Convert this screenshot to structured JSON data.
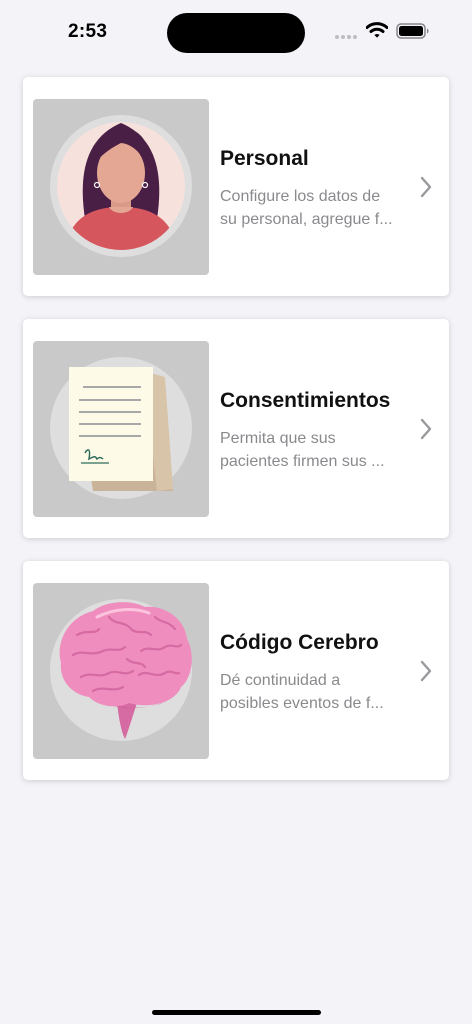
{
  "status_bar": {
    "time": "2:53"
  },
  "cards": [
    {
      "title": "Personal",
      "desc_line1": "Configure los datos de",
      "desc_line2": "su personal, agregue f...",
      "icon": "woman-avatar-icon"
    },
    {
      "title": "Consentimientos",
      "desc_line1": "Permita que sus",
      "desc_line2": "pacientes firmen sus ...",
      "icon": "signed-document-icon"
    },
    {
      "title": "Código Cerebro",
      "desc_line1": "Dé continuidad a",
      "desc_line2": "posibles eventos de f...",
      "icon": "brain-icon"
    }
  ],
  "colors": {
    "background": "#f4f3f8",
    "card": "#ffffff",
    "thumb_bg": "#c9c9c9",
    "subtitle": "#8a8a8e",
    "chevron": "#9a9a9e",
    "brain_pink": "#f08dbf",
    "avatar_hair": "#4a1f45",
    "avatar_shirt": "#d6565e"
  }
}
